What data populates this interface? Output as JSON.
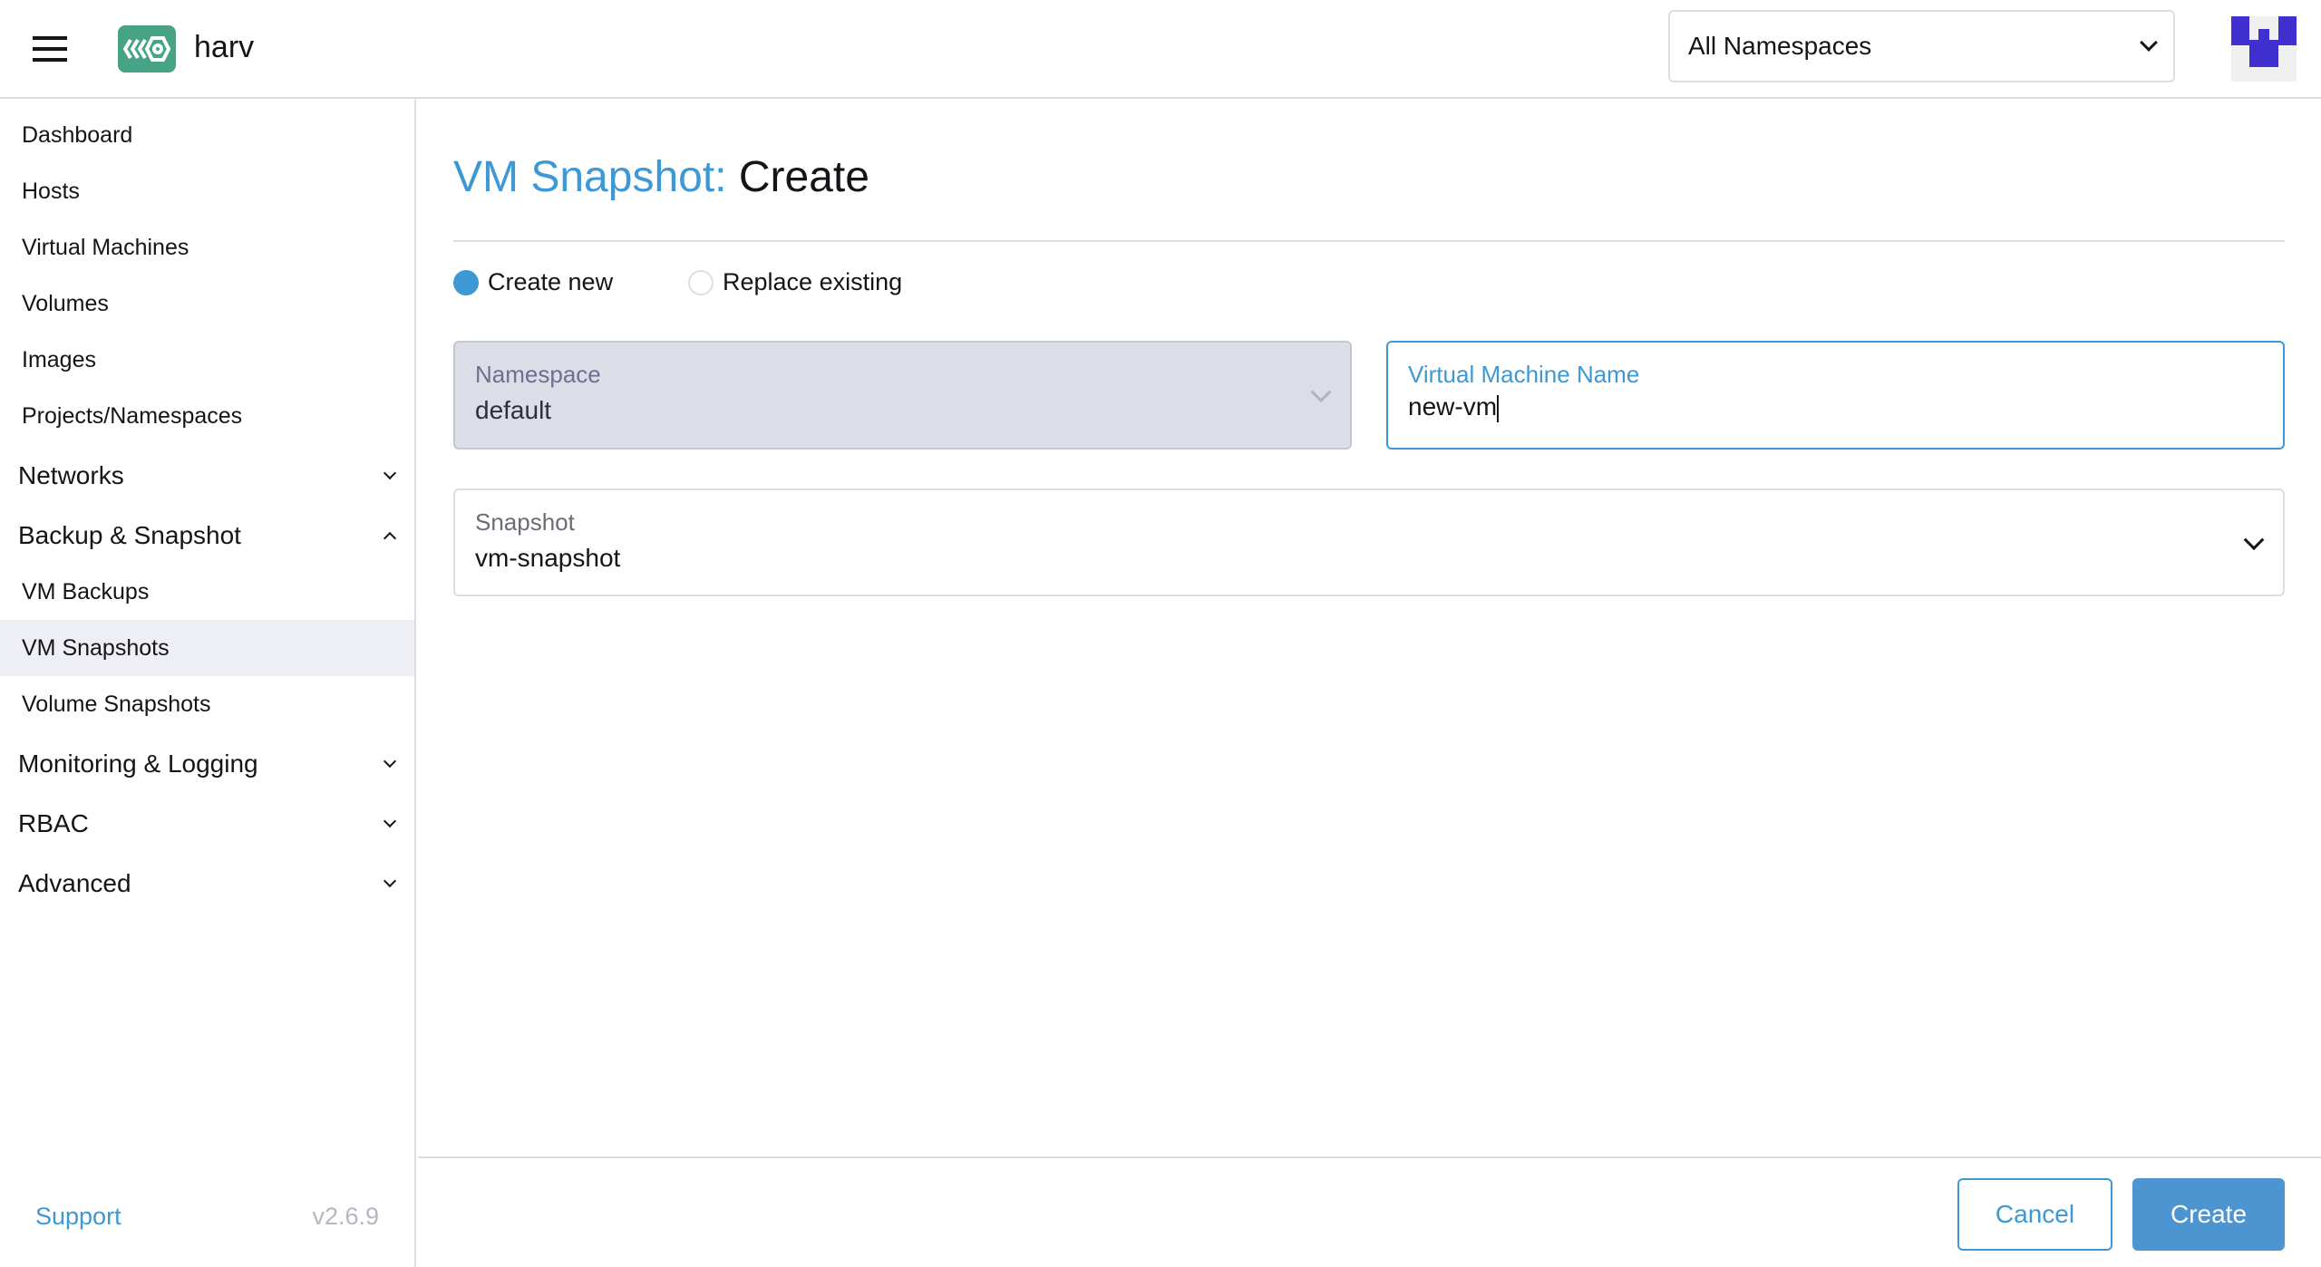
{
  "header": {
    "brand": "harv",
    "namespace_select": "All Namespaces"
  },
  "sidebar": {
    "items": [
      {
        "label": "Dashboard",
        "type": "item"
      },
      {
        "label": "Hosts",
        "type": "item"
      },
      {
        "label": "Virtual Machines",
        "type": "item"
      },
      {
        "label": "Volumes",
        "type": "item"
      },
      {
        "label": "Images",
        "type": "item"
      },
      {
        "label": "Projects/Namespaces",
        "type": "item"
      },
      {
        "label": "Networks",
        "type": "group",
        "expanded": false
      },
      {
        "label": "Backup & Snapshot",
        "type": "group",
        "expanded": true
      },
      {
        "label": "VM Backups",
        "type": "item"
      },
      {
        "label": "VM Snapshots",
        "type": "item",
        "active": true
      },
      {
        "label": "Volume Snapshots",
        "type": "item"
      },
      {
        "label": "Monitoring & Logging",
        "type": "group",
        "expanded": false
      },
      {
        "label": "RBAC",
        "type": "group",
        "expanded": false
      },
      {
        "label": "Advanced",
        "type": "group",
        "expanded": false
      }
    ],
    "support": "Support",
    "version": "v2.6.9"
  },
  "main": {
    "title_prefix": "VM Snapshot:",
    "title": "Create",
    "radios": [
      {
        "label": "Create new",
        "checked": true
      },
      {
        "label": "Replace existing",
        "checked": false
      }
    ],
    "namespace": {
      "label": "Namespace",
      "value": "default",
      "disabled": true
    },
    "vm_name": {
      "label": "Virtual Machine Name",
      "value": "new-vm"
    },
    "snapshot": {
      "label": "Snapshot",
      "value": "vm-snapshot"
    },
    "cancel": "Cancel",
    "create": "Create"
  },
  "colors": {
    "accent": "#3d98d3",
    "logo": "#47a386",
    "avatar": "#4030d0"
  }
}
